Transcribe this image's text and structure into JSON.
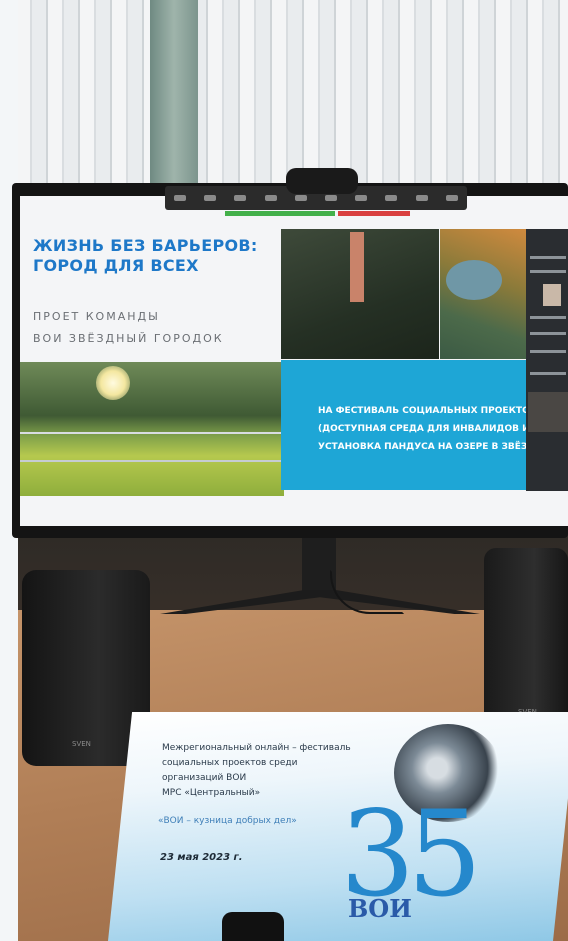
{
  "slide": {
    "title_line1": "ЖИЗНЬ БЕЗ БАРЬЕРОВ:",
    "title_line2": "ГОРОД ДЛЯ ВСЕХ",
    "subtitle_line1": "ПРОЕТ КОМАНДЫ",
    "subtitle_line2": "ВОИ ЗВЁЗДНЫЙ ГОРОДОК",
    "box_line1": "НА ФЕСТИВАЛЬ СОЦИАЛЬНЫХ ПРОЕКТОВ",
    "box_line2": "(ДОСТУПНАЯ СРЕДА ДЛЯ ИНВАЛИДОВ И М",
    "box_line3": "УСТАНОВКА ПАНДУСА НА ОЗЕРЕ В ЗВЁЗД"
  },
  "speakers": {
    "left_label": "SVEN",
    "right_label": "SVEN"
  },
  "poster": {
    "line1": "Межрегиональный онлайн – фестиваль",
    "line2": "социальных проектов среди организаций ВОИ",
    "line3": "МРС «Центральный»",
    "slogan": "«ВОИ – кузница добрых дел»",
    "date": "23 мая 2023 г.",
    "number": "35",
    "logo_text": "ВОИ"
  },
  "colors": {
    "slide_title": "#1e78c8",
    "slide_box": "#1ea6d6",
    "poster_number": "#2588cc"
  }
}
